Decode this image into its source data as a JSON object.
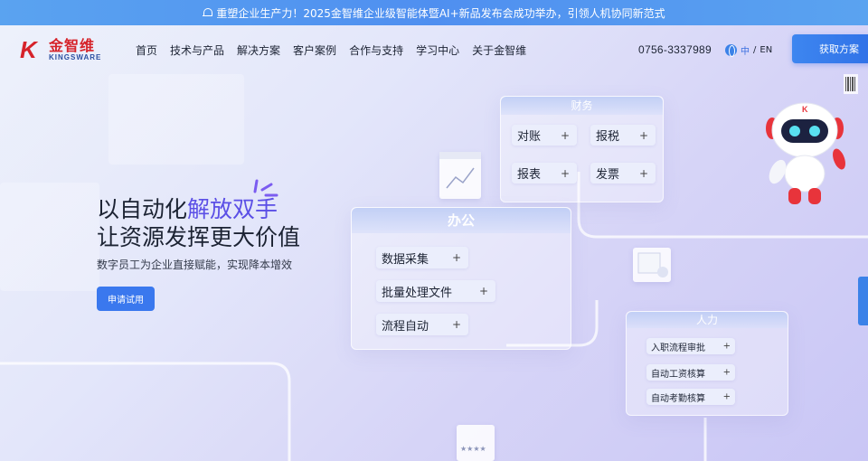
{
  "announcement": {
    "text": "重塑企业生产力！2025金智维企业级智能体暨AI+新品发布会成功举办，引领人机协同新范式"
  },
  "brand": {
    "name_cn": "金智维",
    "name_en": "KINGSWARE",
    "mark": "K",
    "primary_color": "#d6232a",
    "secondary_color": "#2b4fa0"
  },
  "nav": {
    "items": [
      "首页",
      "技术与产品",
      "解决方案",
      "客户案例",
      "合作与支持",
      "学习中心",
      "关于金智维"
    ]
  },
  "header": {
    "phone": "0756-3337989",
    "lang_zh": "中",
    "lang_sep": "/",
    "lang_en": "EN",
    "cta_label": "获取方案",
    "accent": "#3a78ee"
  },
  "hero": {
    "title_line1_plain": "以自动化",
    "title_line1_highlight": "解放双手",
    "title_line2": "让资源发挥更大价值",
    "subtitle": "数字员工为企业直接赋能，实现降本增效",
    "apply_label": "申请试用",
    "highlight_color": "#5b4fe6"
  },
  "panels": {
    "finance": {
      "title": "财务",
      "chips": [
        "对账",
        "报税",
        "报表",
        "发票"
      ]
    },
    "office": {
      "title": "办公",
      "chips": [
        "数据采集",
        "批量处理文件",
        "流程自动"
      ]
    },
    "hr": {
      "title": "人力",
      "chips": [
        "入职流程审批",
        "自动工资核算",
        "自动考勤核算"
      ]
    },
    "plus_symbol": "+"
  },
  "decor": {
    "robot_badge": "K",
    "rating_stars": "★★★★"
  },
  "icons": [
    "bell-icon",
    "globe-icon",
    "sparkle-icon",
    "robot-mascot",
    "chart-card-icon",
    "document-card-icon",
    "barcode-icon"
  ]
}
